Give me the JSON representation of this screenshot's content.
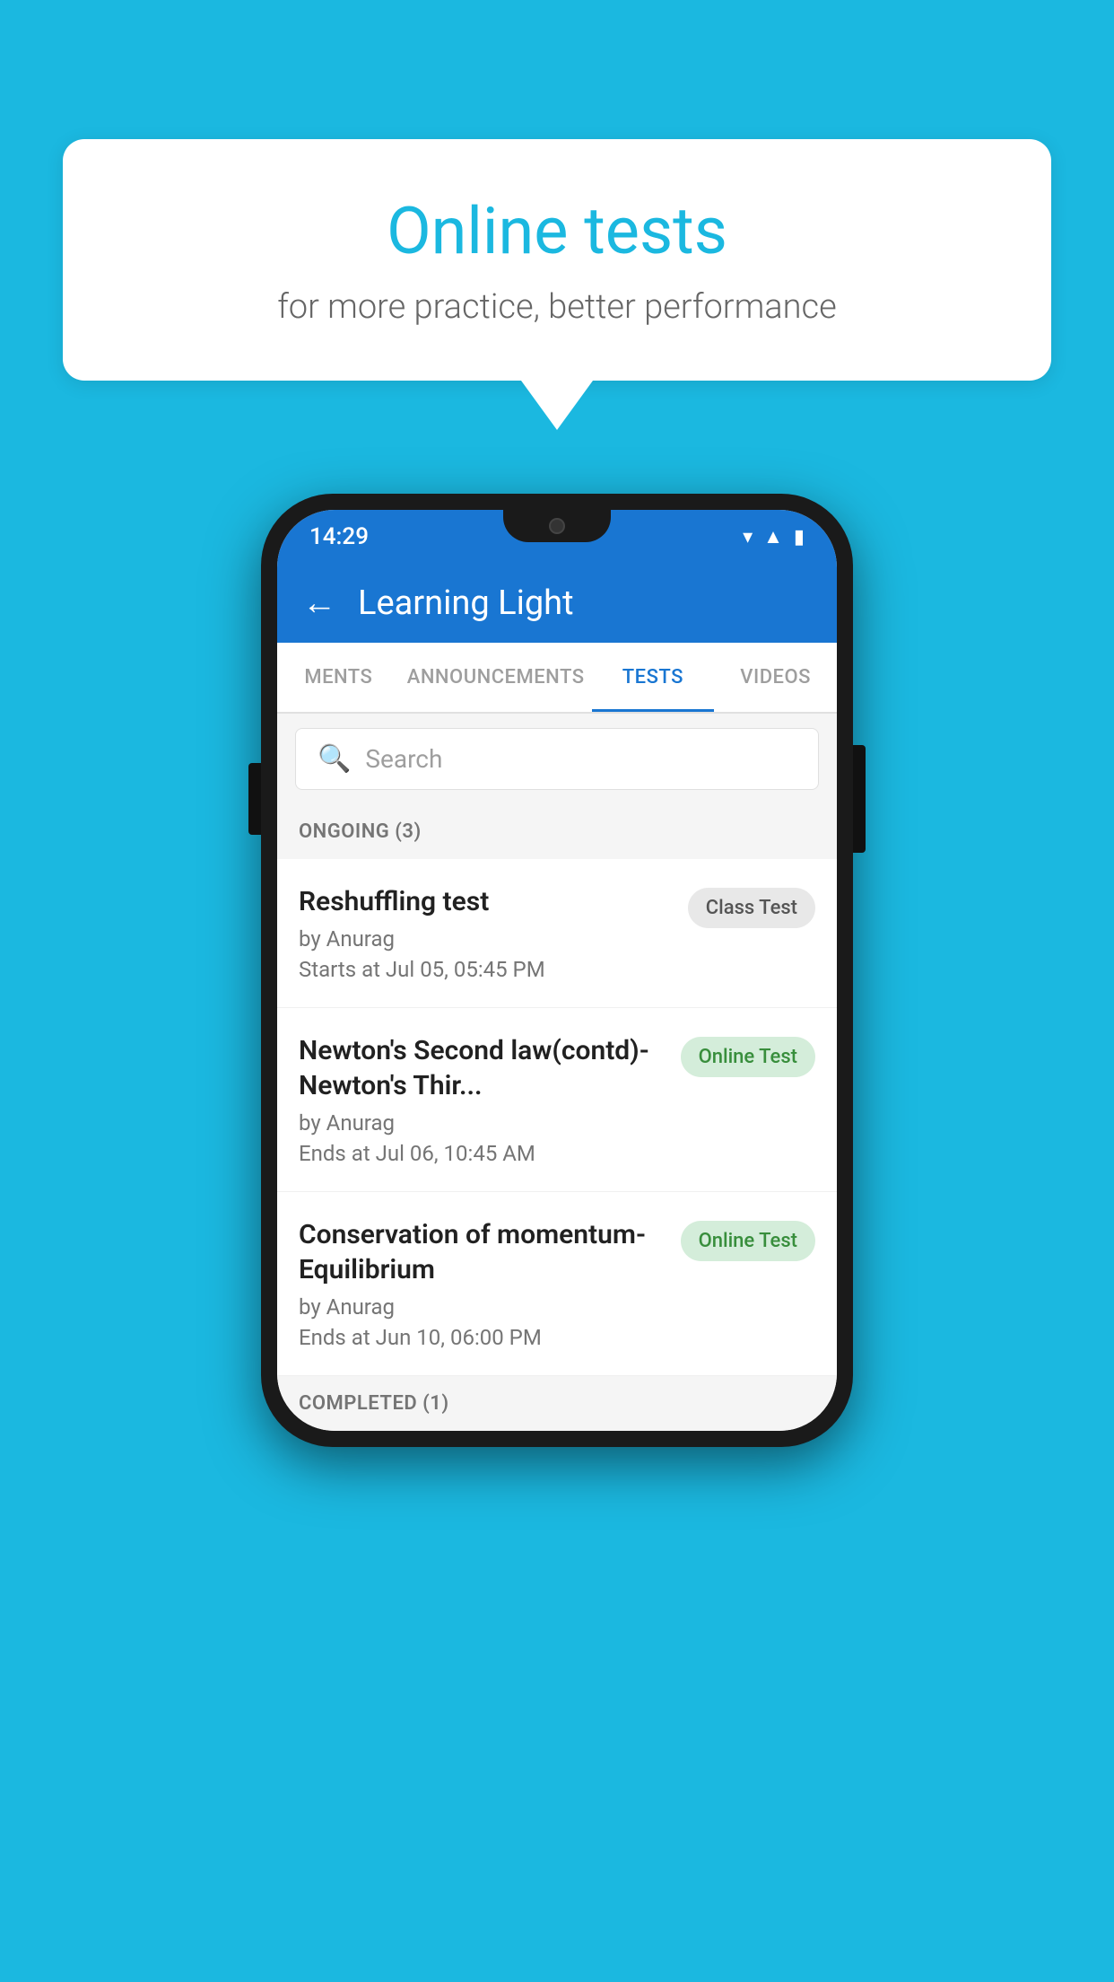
{
  "background_color": "#1BB8E0",
  "speech_bubble": {
    "title": "Online tests",
    "subtitle": "for more practice, better performance"
  },
  "phone": {
    "status_bar": {
      "time": "14:29",
      "icons": [
        "wifi",
        "signal",
        "battery"
      ]
    },
    "app_header": {
      "title": "Learning Light",
      "back_label": "←"
    },
    "tabs": [
      {
        "label": "MENTS",
        "active": false
      },
      {
        "label": "ANNOUNCEMENTS",
        "active": false
      },
      {
        "label": "TESTS",
        "active": true
      },
      {
        "label": "VIDEOS",
        "active": false
      }
    ],
    "search": {
      "placeholder": "Search"
    },
    "ongoing_section": {
      "header": "ONGOING (3)",
      "items": [
        {
          "title": "Reshuffling test",
          "author": "by Anurag",
          "date": "Starts at  Jul 05, 05:45 PM",
          "badge": "Class Test",
          "badge_type": "class"
        },
        {
          "title": "Newton's Second law(contd)-Newton's Thir...",
          "author": "by Anurag",
          "date": "Ends at  Jul 06, 10:45 AM",
          "badge": "Online Test",
          "badge_type": "online"
        },
        {
          "title": "Conservation of momentum-Equilibrium",
          "author": "by Anurag",
          "date": "Ends at  Jun 10, 06:00 PM",
          "badge": "Online Test",
          "badge_type": "online"
        }
      ]
    },
    "completed_section": {
      "header": "COMPLETED (1)"
    }
  }
}
